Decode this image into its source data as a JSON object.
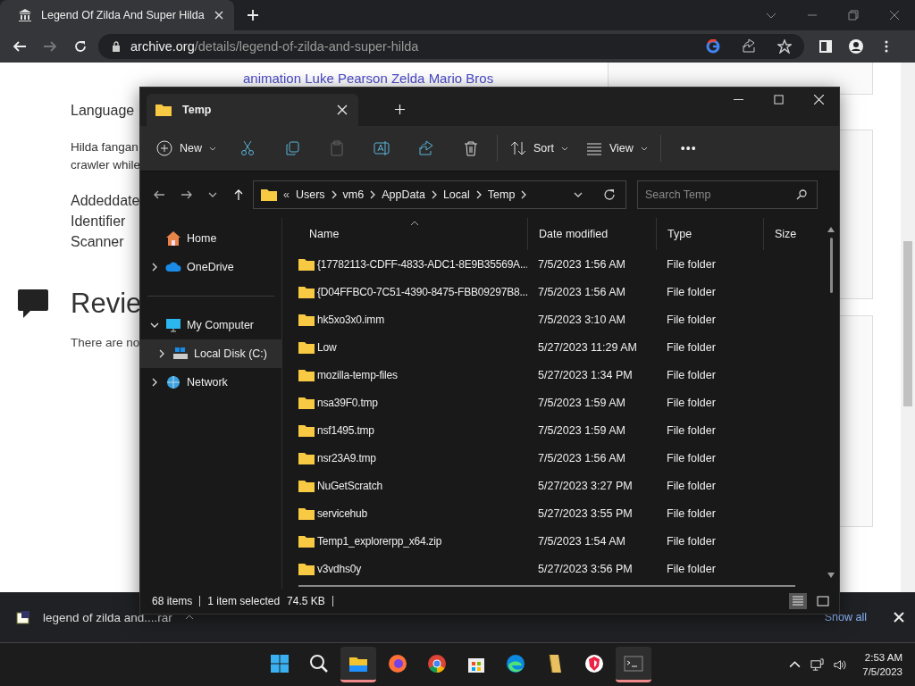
{
  "browser": {
    "tab_title": "Legend Of Zilda And Super Hilda",
    "url_host": "archive.org",
    "url_path": "/details/legend-of-zilda-and-super-hilda"
  },
  "page": {
    "topics_link": "animation Luke  Pearson Zelda Mario  Bros",
    "language_label": "Language",
    "description_lines": [
      "Hilda fangan",
      "crawler while"
    ],
    "meta_labels": [
      "Addeddate",
      "Identifier",
      "Scanner"
    ],
    "reviews_heading": "Revie",
    "reviews_text": "There are no"
  },
  "explorer": {
    "tab_title": "Temp",
    "toolbar": [
      {
        "kind": "new",
        "label": "New"
      },
      {
        "kind": "cut",
        "disabled": false
      },
      {
        "kind": "copy",
        "disabled": false
      },
      {
        "kind": "paste",
        "disabled": true
      },
      {
        "kind": "rename",
        "disabled": false
      },
      {
        "kind": "share",
        "disabled": false
      },
      {
        "kind": "delete",
        "disabled": false
      },
      {
        "kind": "sort",
        "label": "Sort"
      },
      {
        "kind": "view",
        "label": "View"
      },
      {
        "kind": "more",
        "label": "•••"
      }
    ],
    "breadcrumb_prefix": "«",
    "breadcrumb": [
      "Users",
      "vm6",
      "AppData",
      "Local",
      "Temp"
    ],
    "search": {
      "placeholder": "Search Temp"
    },
    "sidebar": [
      {
        "label": "Home",
        "kind": "home",
        "selected": false
      },
      {
        "label": "OneDrive",
        "kind": "cloud",
        "expandable": true,
        "expanded": false,
        "selected": false
      },
      {
        "label": "My Computer",
        "kind": "computer",
        "expandable": true,
        "expanded": true,
        "selected": false,
        "children": [
          {
            "label": "Local Disk (C:)",
            "kind": "disk",
            "expandable": true,
            "expanded": false,
            "selected": true
          }
        ]
      },
      {
        "label": "Network",
        "kind": "network",
        "expandable": true,
        "expanded": false,
        "selected": false
      }
    ],
    "columns": [
      "Name",
      "Date modified",
      "Type",
      "Size"
    ],
    "rows": [
      {
        "name": "{17782113-CDFF-4833-ADC1-8E9B35569A...",
        "date": "7/5/2023 1:56 AM",
        "type": "File folder"
      },
      {
        "name": "{D04FFBC0-7C51-4390-8475-FBB09297B8...",
        "date": "7/5/2023 1:56 AM",
        "type": "File folder"
      },
      {
        "name": "hk5xo3x0.imm",
        "date": "7/5/2023 3:10 AM",
        "type": "File folder"
      },
      {
        "name": "Low",
        "date": "5/27/2023 11:29 AM",
        "type": "File folder"
      },
      {
        "name": "mozilla-temp-files",
        "date": "5/27/2023 1:34 PM",
        "type": "File folder"
      },
      {
        "name": "nsa39F0.tmp",
        "date": "7/5/2023 1:59 AM",
        "type": "File folder"
      },
      {
        "name": "nsf1495.tmp",
        "date": "7/5/2023 1:59 AM",
        "type": "File folder"
      },
      {
        "name": "nsr23A9.tmp",
        "date": "7/5/2023 1:56 AM",
        "type": "File folder"
      },
      {
        "name": "NuGetScratch",
        "date": "5/27/2023 3:27 PM",
        "type": "File folder"
      },
      {
        "name": "servicehub",
        "date": "5/27/2023 3:55 PM",
        "type": "File folder"
      },
      {
        "name": "Temp1_explorerpp_x64.zip",
        "date": "7/5/2023 1:54 AM",
        "type": "File folder"
      },
      {
        "name": "v3vdhs0y",
        "date": "5/27/2023 3:56 PM",
        "type": "File folder"
      }
    ],
    "status": {
      "count": "68 items",
      "selection": "1 item selected",
      "size": "74.5 KB"
    },
    "view_modes": [
      {
        "kind": "details",
        "selected": true
      },
      {
        "kind": "tiles",
        "selected": false
      }
    ]
  },
  "download_bar": {
    "file": "legend of zilda and....rar",
    "show_all": "Show all"
  },
  "taskbar": {
    "apps": [
      {
        "kind": "start",
        "active": false
      },
      {
        "kind": "search",
        "active": false
      },
      {
        "kind": "explorer",
        "active": true
      },
      {
        "kind": "firefox",
        "active": false
      },
      {
        "kind": "chrome",
        "active": false
      },
      {
        "kind": "store",
        "active": false
      },
      {
        "kind": "edge",
        "active": false
      },
      {
        "kind": "folder",
        "active": false
      },
      {
        "kind": "shield",
        "active": false
      },
      {
        "kind": "terminal",
        "active": true
      }
    ],
    "time": "2:53 AM",
    "date": "7/5/2023"
  }
}
